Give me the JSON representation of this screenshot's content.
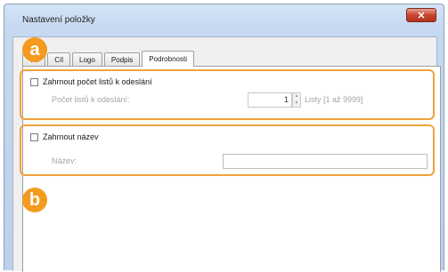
{
  "window": {
    "title": "Nastavení položky",
    "close_glyph": "✕"
  },
  "tabs": [
    "Tel",
    "Cíl",
    "Logo",
    "Podpis",
    "Podrobnosti"
  ],
  "active_tab_index": 4,
  "section_pages": {
    "checkbox_label": "Zahrnout počet listů k odeslání",
    "checked": false,
    "field_label": "Počet listů k odeslání:",
    "value": "1",
    "unit_label": "Listy [1 až 9999]"
  },
  "section_name": {
    "checkbox_label": "Zahrnout název",
    "checked": false,
    "field_label": "Název:",
    "value": ""
  },
  "callouts": {
    "a": "a",
    "b": "b"
  },
  "colors": {
    "accent_orange": "#f39a1f",
    "group_border": "#f0a13a"
  }
}
